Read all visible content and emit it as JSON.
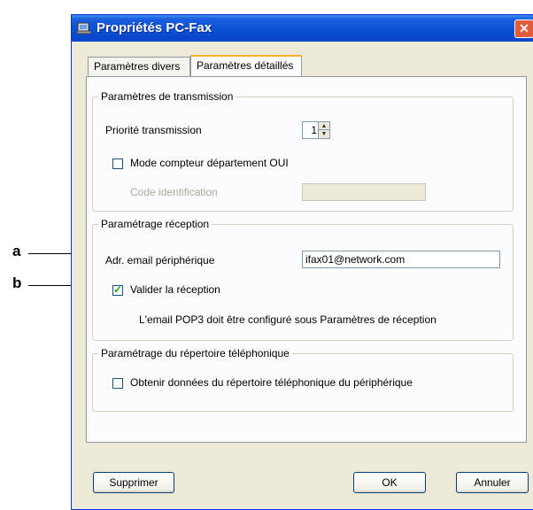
{
  "window": {
    "title": "Propriétés PC-Fax",
    "close_symbol": "✕"
  },
  "tabs": [
    {
      "label": "Paramètres divers",
      "active": false
    },
    {
      "label": "Paramètres détaillés",
      "active": true
    }
  ],
  "transmission": {
    "group_label": "Paramètres de transmission",
    "priority_label": "Priorité transmission",
    "priority_value": "1",
    "dept_counter_label": "Mode compteur département OUI",
    "dept_counter_checked": false,
    "code_label": "Code identification",
    "code_value": ""
  },
  "reception": {
    "group_label": "Paramétrage réception",
    "email_label": "Adr. email périphérique",
    "email_value": "ifax01@network.com",
    "validate_label": "Valider la réception",
    "validate_checked": true,
    "note": "L'email POP3 doit être configuré sous Paramètres de réception"
  },
  "phonebook": {
    "group_label": "Paramétrage du répertoire téléphonique",
    "obtain_label": "Obtenir données du répertoire téléphonique du périphérique",
    "obtain_checked": false
  },
  "buttons": {
    "delete": "Supprimer",
    "ok": "OK",
    "cancel": "Annuler"
  },
  "annotations": {
    "a": "a",
    "b": "b"
  },
  "colors": {
    "titlebar": "#0a4fd4",
    "dialog_bg": "#ece9d8",
    "checkmark": "#21a121"
  }
}
